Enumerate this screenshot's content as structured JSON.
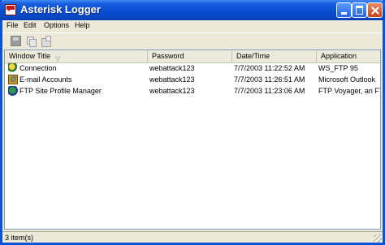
{
  "window": {
    "title": "Asterisk Logger"
  },
  "menu": [
    "File",
    "Edit",
    "Options",
    "Help"
  ],
  "toolbar": {
    "icons": [
      "save-icon",
      "copy-icon",
      "properties-icon"
    ]
  },
  "columns": [
    "Window Title",
    "Password",
    "Date/Time",
    "Application"
  ],
  "rows": [
    {
      "icon": "connection-icon",
      "title": "Connection",
      "password": "webattack123",
      "datetime": "7/7/2003 11:22:52 AM",
      "application": "WS_FTP 95"
    },
    {
      "icon": "email-icon",
      "title": "E-mail Accounts",
      "password": "webattack123",
      "datetime": "7/7/2003 11:26:51 AM",
      "application": "Microsoft Outlook"
    },
    {
      "icon": "ftp-icon",
      "title": "FTP Site Profile Manager",
      "password": "webattack123",
      "datetime": "7/7/2003 11:23:06 AM",
      "application": "FTP Voyager, an FTP"
    }
  ],
  "status": {
    "text": "3 item(s)"
  },
  "colors": {
    "titlebar": "#0a4fd4",
    "window_bg": "#ece9d8",
    "list_bg": "#ffffff"
  }
}
